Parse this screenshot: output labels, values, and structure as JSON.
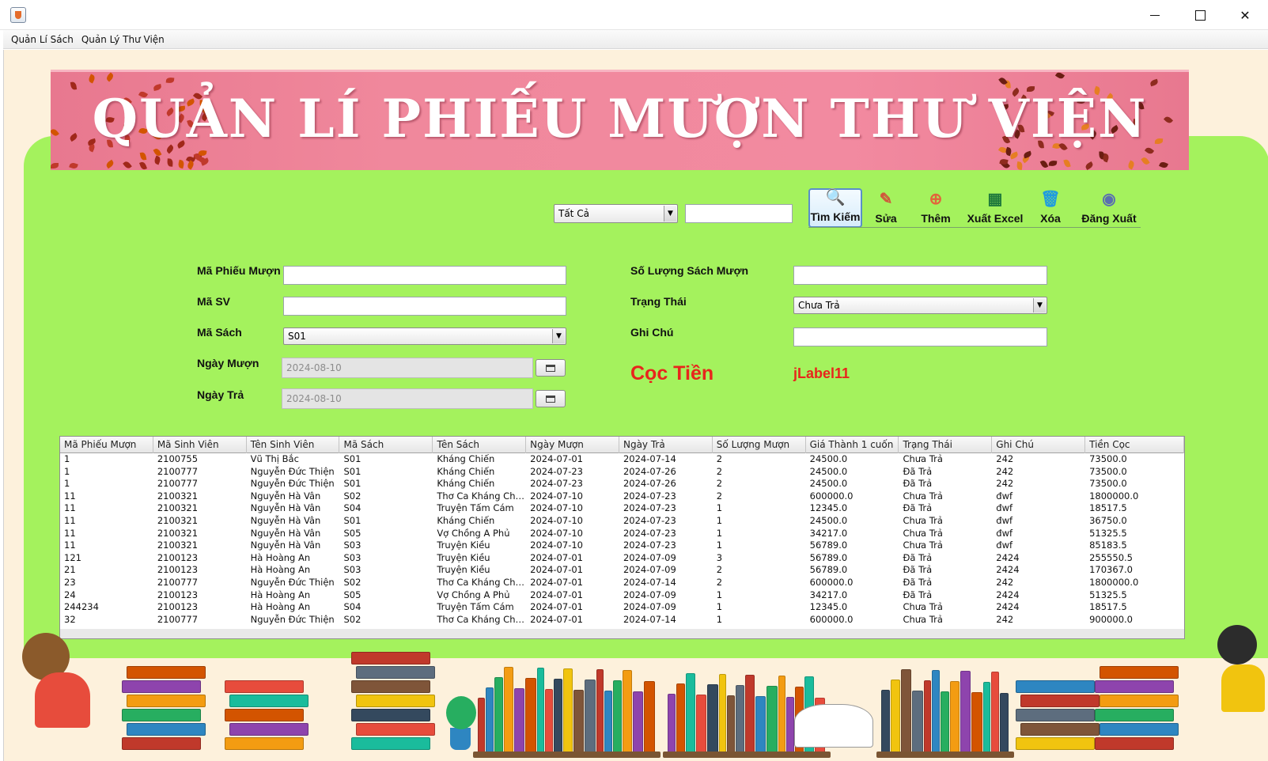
{
  "window": {
    "title": "",
    "controls": {
      "minimize": "minimize-icon",
      "maximize": "maximize-icon",
      "close": "✕"
    }
  },
  "menu": [
    "Quản Lí Sách",
    "Quản Lý Thư Viện"
  ],
  "banner": {
    "title": "QUẢN LÍ PHIẾU MƯỢN THƯ VIỆN"
  },
  "toolbar": {
    "filter_value": "Tất Cả",
    "search_value": "",
    "buttons": [
      {
        "label": "Tìm Kiếm",
        "icon": "🔍"
      },
      {
        "label": "Sửa",
        "icon": "✎"
      },
      {
        "label": "Thêm",
        "icon": "⊕"
      },
      {
        "label": "Xuất Excel",
        "icon": "▦"
      },
      {
        "label": "Xóa",
        "icon": "🗑"
      },
      {
        "label": "Đăng Xuất",
        "icon": "◉"
      }
    ]
  },
  "form": {
    "ma_phieu_muon_label": "Mã Phiếu Mượn",
    "ma_sv_label": "Mã SV",
    "ma_sach_label": "Mã Sách",
    "ma_sach_value": "S01",
    "ngay_muon_label": "Ngày Mượn",
    "ngay_muon_value": "2024-08-10",
    "ngay_tra_label": "Ngày Trả",
    "ngay_tra_value": "2024-08-10",
    "so_luong_label": "Số Lượng Sách Mượn",
    "trang_thai_label": "Trạng Thái",
    "trang_thai_value": "Chưa Trả",
    "ghi_chu_label": "Ghi Chú",
    "coc_tien_label": "Cọc Tiền",
    "coc_tien_value": "jLabel11"
  },
  "table": {
    "columns": [
      "Mã Phiếu Mượn",
      "Mã Sinh Viên",
      "Tên Sinh Viên",
      "Mã Sách",
      "Tên Sách",
      "Ngày Mượn",
      "Ngày Trả",
      "Số Lượng Mượn",
      "Giá Thành 1 cuốn",
      "Trạng Thái",
      "Ghi Chú",
      "Tiền Cọc"
    ],
    "rows": [
      [
        "1",
        "2100755",
        "Vũ Thị Bắc",
        "S01",
        "Kháng Chiến",
        "2024-07-01",
        "2024-07-14",
        "2",
        "24500.0",
        "Chưa Trả",
        "242",
        "73500.0"
      ],
      [
        "1",
        "2100777",
        "Nguyễn Đức Thiện",
        "S01",
        "Kháng Chiến",
        "2024-07-23",
        "2024-07-26",
        "2",
        "24500.0",
        "Đã Trả",
        "242",
        "73500.0"
      ],
      [
        "1",
        "2100777",
        "Nguyễn Đức Thiện",
        "S01",
        "Kháng Chiến",
        "2024-07-23",
        "2024-07-26",
        "2",
        "24500.0",
        "Đã Trả",
        "242",
        "73500.0"
      ],
      [
        "11",
        "2100321",
        "Nguyễn Hà Vân",
        "S02",
        "Thơ Ca Kháng Chi...",
        "2024-07-10",
        "2024-07-23",
        "2",
        "600000.0",
        "Chưa Trả",
        "đwf",
        "1800000.0"
      ],
      [
        "11",
        "2100321",
        "Nguyễn Hà Vân",
        "S04",
        "Truyện Tấm Cám",
        "2024-07-10",
        "2024-07-23",
        "1",
        "12345.0",
        "Đã Trả",
        "đwf",
        "18517.5"
      ],
      [
        "11",
        "2100321",
        "Nguyễn Hà Vân",
        "S01",
        "Kháng Chiến",
        "2024-07-10",
        "2024-07-23",
        "1",
        "24500.0",
        "Chưa Trả",
        "đwf",
        "36750.0"
      ],
      [
        "11",
        "2100321",
        "Nguyễn Hà Vân",
        "S05",
        "Vợ Chồng A Phủ",
        "2024-07-10",
        "2024-07-23",
        "1",
        "34217.0",
        "Chưa Trả",
        "đwf",
        "51325.5"
      ],
      [
        "11",
        "2100321",
        "Nguyễn Hà Vân",
        "S03",
        "Truyện Kiều",
        "2024-07-10",
        "2024-07-23",
        "1",
        "56789.0",
        "Chưa Trả",
        "đwf",
        "85183.5"
      ],
      [
        "121",
        "2100123",
        "Hà Hoàng An",
        "S03",
        "Truyện Kiều",
        "2024-07-01",
        "2024-07-09",
        "3",
        "56789.0",
        "Đã Trả",
        "2424",
        "255550.5"
      ],
      [
        "21",
        "2100123",
        "Hà Hoàng An",
        "S03",
        "Truyện Kiều",
        "2024-07-01",
        "2024-07-09",
        "2",
        "56789.0",
        "Đã Trả",
        "2424",
        "170367.0"
      ],
      [
        "23",
        "2100777",
        "Nguyễn Đức Thiện",
        "S02",
        "Thơ Ca Kháng Chi...",
        "2024-07-01",
        "2024-07-14",
        "2",
        "600000.0",
        "Đã Trả",
        "242",
        "1800000.0"
      ],
      [
        "24",
        "2100123",
        "Hà Hoàng An",
        "S05",
        "Vợ Chồng A Phủ",
        "2024-07-01",
        "2024-07-09",
        "1",
        "34217.0",
        "Đã Trả",
        "2424",
        "51325.5"
      ],
      [
        "244234",
        "2100123",
        "Hà Hoàng An",
        "S04",
        "Truyện Tấm Cám",
        "2024-07-01",
        "2024-07-09",
        "1",
        "12345.0",
        "Chưa Trả",
        "2424",
        "18517.5"
      ],
      [
        "32",
        "2100777",
        "Nguyễn Đức Thiện",
        "S02",
        "Thơ Ca Kháng Chi...",
        "2024-07-01",
        "2024-07-14",
        "1",
        "600000.0",
        "Chưa Trả",
        "242",
        "900000.0"
      ]
    ]
  },
  "colors": {
    "panel_green": "#a4f25d",
    "banner_pink": "#f0889c",
    "deposit_red": "#e8251c",
    "frame_cream": "#fdf1dc"
  }
}
